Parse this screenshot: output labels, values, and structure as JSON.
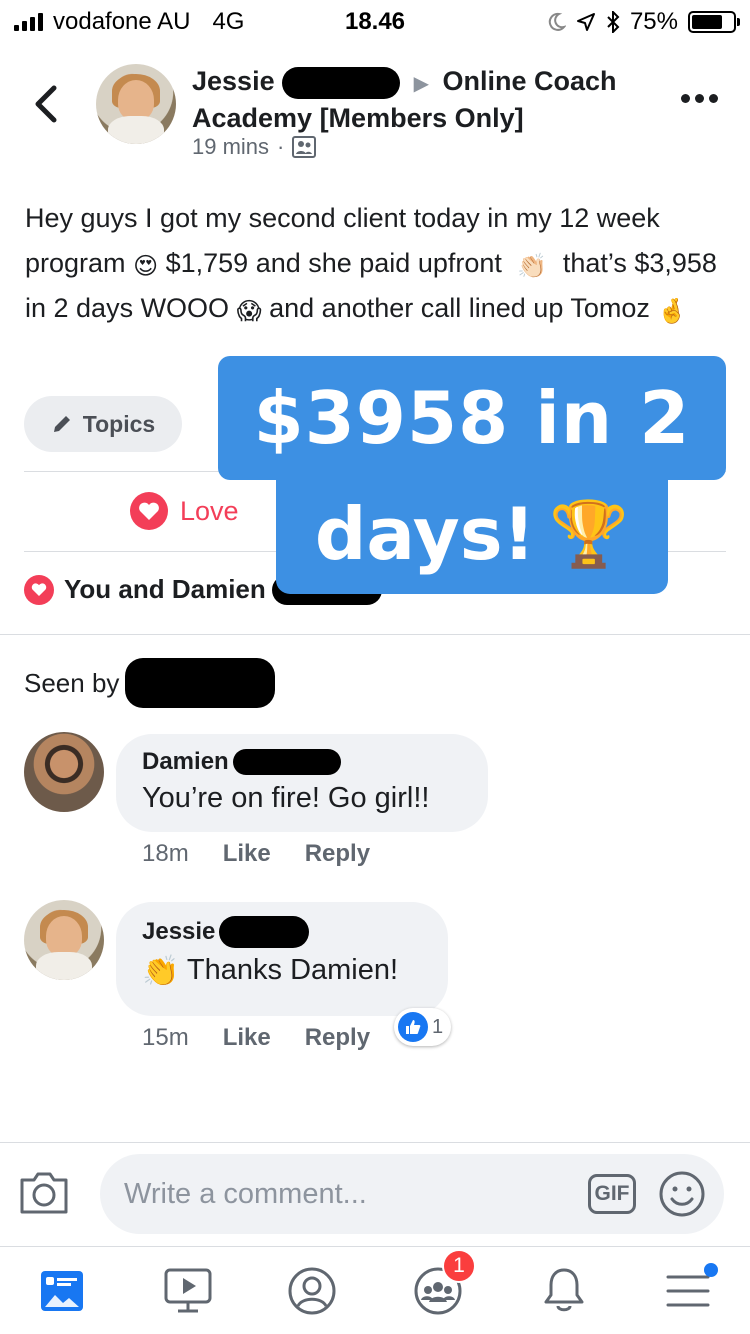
{
  "status_bar": {
    "carrier": "vodafone AU",
    "network": "4G",
    "time": "18.46",
    "battery": "75%"
  },
  "post": {
    "author_first": "Jessie",
    "group_name": "Online Coach Academy [Members Only]",
    "time_ago": "19 mins",
    "separator": "·",
    "text_part1": "Hey guys I got my second client today in my 12 week program",
    "emoji1": "😍",
    "text_part2": "$1,759 and she paid upfront",
    "emoji2": "👏🏻",
    "text_part3": "that’s $3,958 in 2 days WOOO",
    "emoji3": "😱",
    "text_part4": "and another call lined up Tomoz",
    "emoji4": "🤞",
    "topics_label": "Topics",
    "love_label": "Love",
    "reactions_text": "You and Damien",
    "seen_by_label": "Seen by"
  },
  "banner": {
    "line1": "$3958 in 2",
    "line2": "days!",
    "emoji": "🏆",
    "color": "#3d90e3"
  },
  "comments": [
    {
      "author_first": "Damien",
      "text": "You’re on fire! Go girl!!",
      "time": "18m",
      "like_label": "Like",
      "reply_label": "Reply"
    },
    {
      "author_first": "Jessie",
      "emoji": "👏",
      "text": "Thanks Damien!",
      "time": "15m",
      "like_label": "Like",
      "reply_label": "Reply",
      "like_count": "1"
    }
  ],
  "composer": {
    "placeholder": "Write a comment...",
    "gif_label": "GIF"
  },
  "tab_bar": {
    "groups_badge": "1",
    "accent": "#1877f2"
  }
}
